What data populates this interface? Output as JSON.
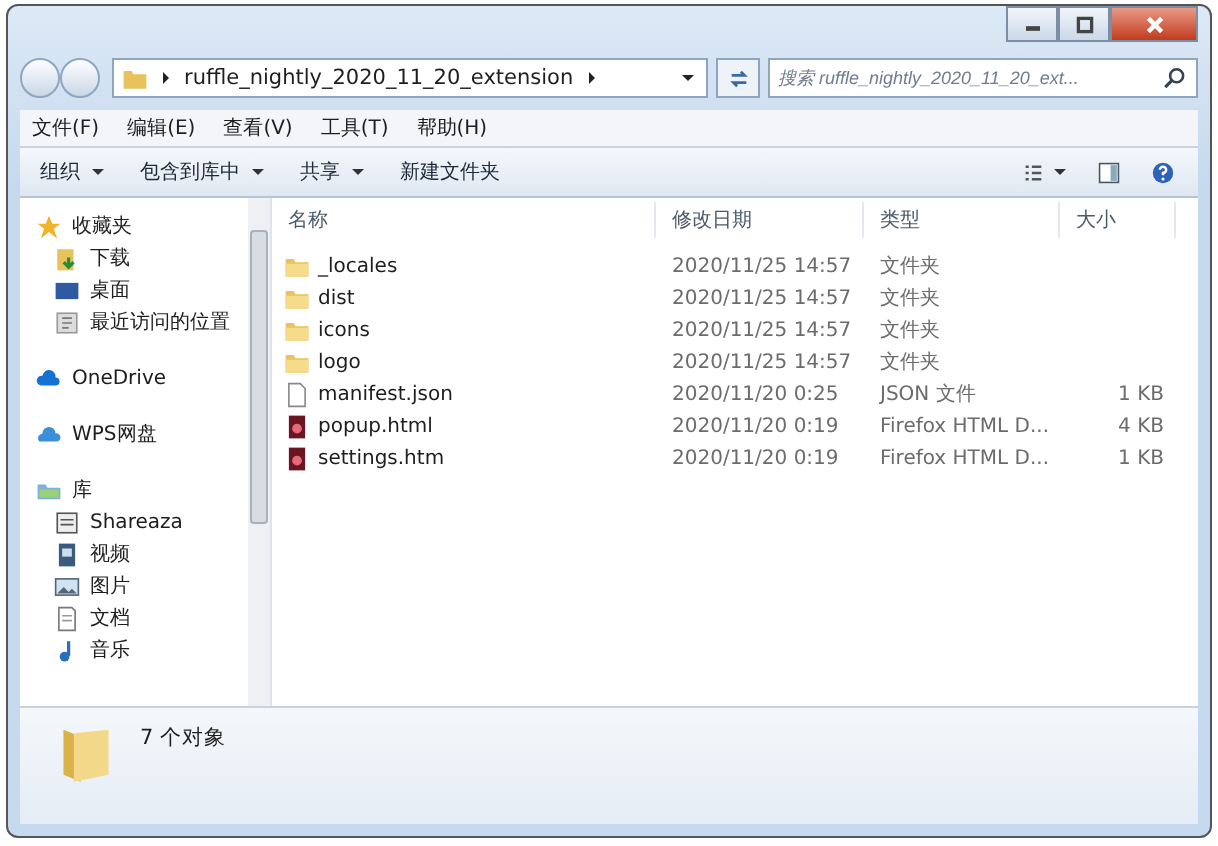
{
  "address_bar": {
    "path": "ruffle_nightly_2020_11_20_extension"
  },
  "search": {
    "placeholder": "搜索 ruffle_nightly_2020_11_20_ext..."
  },
  "menu_bar": [
    "文件(F)",
    "编辑(E)",
    "查看(V)",
    "工具(T)",
    "帮助(H)"
  ],
  "toolbar": [
    {
      "label": "组织",
      "dropdown": true
    },
    {
      "label": "包含到库中",
      "dropdown": true
    },
    {
      "label": "共享",
      "dropdown": true
    },
    {
      "label": "新建文件夹",
      "dropdown": false
    }
  ],
  "sidebar": {
    "groups": [
      {
        "label": "收藏夹",
        "kind": "star",
        "children": [
          {
            "label": "下载",
            "kind": "download"
          },
          {
            "label": "桌面",
            "kind": "desktop"
          },
          {
            "label": "最近访问的位置",
            "kind": "recent"
          }
        ]
      },
      {
        "label": "OneDrive",
        "kind": "cloud"
      },
      {
        "label": "WPS网盘",
        "kind": "wps"
      },
      {
        "label": "库",
        "kind": "library",
        "children": [
          {
            "label": "Shareaza",
            "kind": "app"
          },
          {
            "label": "视频",
            "kind": "video"
          },
          {
            "label": "图片",
            "kind": "picture"
          },
          {
            "label": "文档",
            "kind": "document"
          },
          {
            "label": "音乐",
            "kind": "music"
          }
        ]
      }
    ]
  },
  "table": {
    "columns": [
      "名称",
      "修改日期",
      "类型",
      "大小"
    ],
    "rows": [
      {
        "kind": "folder",
        "name": "_locales",
        "date": "2020/11/25 14:57",
        "type": "文件夹"
      },
      {
        "kind": "folder",
        "name": "dist",
        "date": "2020/11/25 14:57",
        "type": "文件夹"
      },
      {
        "kind": "folder",
        "name": "icons",
        "date": "2020/11/25 14:57",
        "type": "文件夹"
      },
      {
        "kind": "folder",
        "name": "logo",
        "date": "2020/11/25 14:57",
        "type": "文件夹"
      },
      {
        "kind": "file",
        "name": "manifest.json",
        "date": "2020/11/20 0:25",
        "type": "JSON 文件",
        "size": "1 KB"
      },
      {
        "kind": "html",
        "name": "popup.html",
        "date": "2020/11/20 0:19",
        "type": "Firefox HTML D...",
        "size": "4 KB"
      },
      {
        "kind": "html",
        "name": "settings.htm",
        "date": "2020/11/20 0:19",
        "type": "Firefox HTML D...",
        "size": "1 KB"
      }
    ]
  },
  "status_bar": {
    "text": "7 个对象"
  }
}
